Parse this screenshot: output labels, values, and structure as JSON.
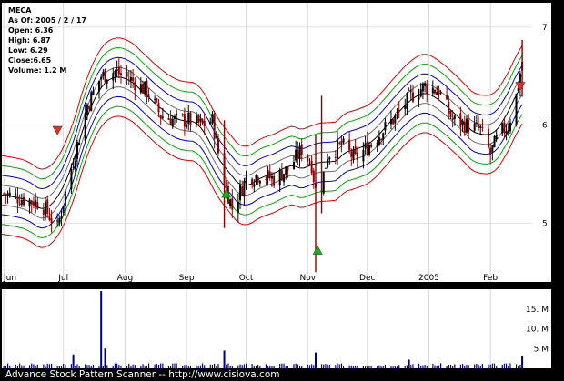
{
  "app": {
    "footer": "Advance Stock Pattern Scanner -- http://www.cisiova.com"
  },
  "info": {
    "symbol": "MECA",
    "as_of": "As Of: 2005 / 2 / 17",
    "open": "Open: 6.36",
    "high": "High: 6.87",
    "low": "Low: 6.29",
    "close": "Close:6.65",
    "volume": "Volume: 1.2 M"
  },
  "colors": {
    "background": "#ffffff",
    "frame": "#000000",
    "up_bar": "#000000",
    "down_bar": "#8b0000",
    "band_center": "#000000",
    "band_inner": "#6b6b6b",
    "band_blue": "#0000cc",
    "band_green": "#00aa00",
    "band_red": "#dd0000",
    "marker_buy": "#22aa22",
    "marker_sell": "#dd3333",
    "volume_bar": "#000080"
  },
  "chart_data": [
    {
      "type": "candlestick",
      "title": "",
      "x_tick_labels": [
        "Jun",
        "Jul",
        "Aug",
        "Sep",
        "Oct",
        "Nov",
        "Dec",
        "2005",
        "Feb"
      ],
      "y_tick_labels": [
        "5",
        "6",
        "7"
      ],
      "ylim": [
        4.4,
        7.25
      ],
      "grid": true,
      "period": "2004-06 to 2005-02-17",
      "price_points": [
        [
          "2004-06-01",
          5.3
        ],
        [
          "2004-06-10",
          5.25
        ],
        [
          "2004-06-20",
          5.2
        ],
        [
          "2004-06-28",
          4.95
        ],
        [
          "2004-07-03",
          5.4
        ],
        [
          "2004-07-08",
          5.8
        ],
        [
          "2004-07-13",
          6.2
        ],
        [
          "2004-07-20",
          6.5
        ],
        [
          "2004-07-27",
          6.55
        ],
        [
          "2004-08-05",
          6.45
        ],
        [
          "2004-08-12",
          6.35
        ],
        [
          "2004-08-19",
          6.1
        ],
        [
          "2004-08-26",
          6.05
        ],
        [
          "2004-09-02",
          6.05
        ],
        [
          "2004-09-09",
          6.0
        ],
        [
          "2004-09-14",
          6.05
        ],
        [
          "2004-09-19",
          5.5
        ],
        [
          "2004-09-24",
          5.15
        ],
        [
          "2004-10-01",
          5.45
        ],
        [
          "2004-10-08",
          5.5
        ],
        [
          "2004-10-15",
          5.45
        ],
        [
          "2004-10-22",
          5.55
        ],
        [
          "2004-10-29",
          5.75
        ],
        [
          "2004-11-03",
          5.6
        ],
        [
          "2004-11-06",
          5.2
        ],
        [
          "2004-11-11",
          5.7
        ],
        [
          "2004-11-18",
          5.8
        ],
        [
          "2004-11-25",
          5.65
        ],
        [
          "2004-12-02",
          5.8
        ],
        [
          "2004-12-09",
          5.95
        ],
        [
          "2004-12-16",
          6.1
        ],
        [
          "2004-12-23",
          6.3
        ],
        [
          "2004-12-30",
          6.4
        ],
        [
          "2005-01-06",
          6.35
        ],
        [
          "2005-01-13",
          6.05
        ],
        [
          "2005-01-20",
          6.0
        ],
        [
          "2005-01-27",
          5.95
        ],
        [
          "2005-02-01",
          5.7
        ],
        [
          "2005-02-05",
          5.9
        ],
        [
          "2005-02-10",
          6.0
        ],
        [
          "2005-02-14",
          6.3
        ],
        [
          "2005-02-17",
          6.65
        ]
      ],
      "envelope_bands": [
        {
          "color": "red",
          "offset": 0.4
        },
        {
          "color": "green",
          "offset": 0.3
        },
        {
          "color": "blue",
          "offset": 0.2
        },
        {
          "color": "gray",
          "offset": 0.1
        },
        {
          "color": "black",
          "offset": 0.0
        },
        {
          "color": "gray",
          "offset": -0.1
        },
        {
          "color": "blue",
          "offset": -0.2
        },
        {
          "color": "green",
          "offset": -0.3
        },
        {
          "color": "red",
          "offset": -0.4
        }
      ],
      "markers": [
        {
          "kind": "sell",
          "date": "2004-06-28",
          "price": 5.95
        },
        {
          "kind": "buy",
          "date": "2004-09-21",
          "price": 5.3
        },
        {
          "kind": "buy",
          "date": "2004-11-06",
          "price": 4.72
        },
        {
          "kind": "sell",
          "date": "2005-02-16",
          "price": 6.4
        }
      ]
    },
    {
      "type": "bar",
      "title": "",
      "y_tick_labels": [
        "15. M",
        "10. M",
        "5 M"
      ],
      "ylim": [
        0,
        20
      ],
      "unit": "M",
      "spikes": [
        {
          "date": "2004-07-20",
          "value": 19.5
        },
        {
          "date": "2004-07-22",
          "value": 5.0
        },
        {
          "date": "2004-07-06",
          "value": 3.5
        },
        {
          "date": "2004-09-20",
          "value": 4.5
        },
        {
          "date": "2004-11-05",
          "value": 4.0
        },
        {
          "date": "2004-12-22",
          "value": 2.2
        },
        {
          "date": "2005-02-17",
          "value": 3.0
        }
      ],
      "baseline_volume": 0.4
    }
  ]
}
